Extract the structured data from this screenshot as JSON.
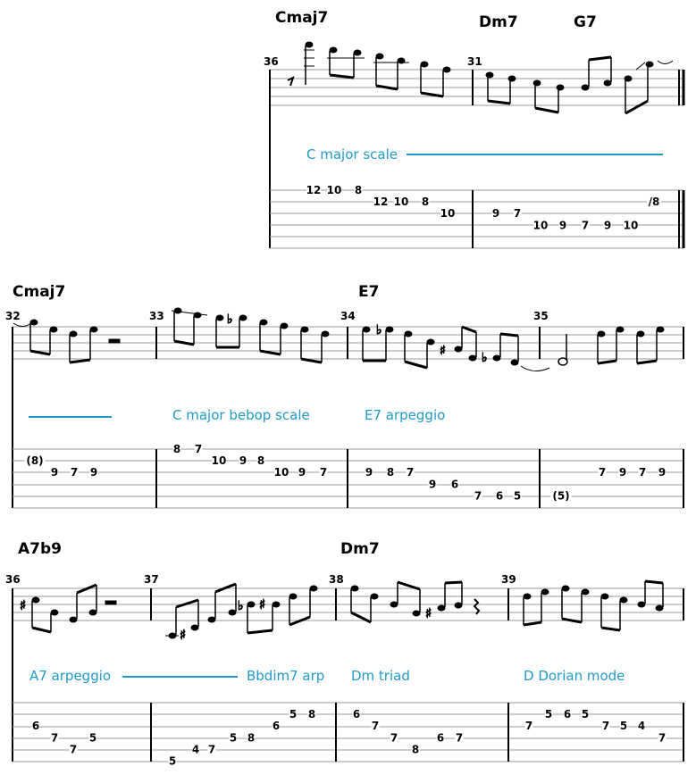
{
  "colors": {
    "annotation": "#1f9ac6",
    "ink": "#000000",
    "staff_line": "#9a9a9a"
  },
  "systems": [
    {
      "id": "system-1",
      "chords": [
        {
          "label": "Cmaj7"
        },
        {
          "label": "Dm7"
        },
        {
          "label": "G7"
        }
      ],
      "measures": [
        {
          "number": "36",
          "tab": [
            {
              "string": 1,
              "fret": "12"
            },
            {
              "string": 1,
              "fret": "10"
            },
            {
              "string": 1,
              "fret": "8"
            },
            {
              "string": 2,
              "fret": "12"
            },
            {
              "string": 2,
              "fret": "10"
            },
            {
              "string": 2,
              "fret": "8"
            },
            {
              "string": 3,
              "fret": "10"
            }
          ]
        },
        {
          "number": "31",
          "tab": [
            {
              "string": 3,
              "fret": "9"
            },
            {
              "string": 3,
              "fret": "7"
            },
            {
              "string": 4,
              "fret": "10"
            },
            {
              "string": 4,
              "fret": "9"
            },
            {
              "string": 4,
              "fret": "7"
            },
            {
              "string": 4,
              "fret": "9"
            },
            {
              "string": 4,
              "fret": "10"
            },
            {
              "string": 2,
              "fret": "/8"
            }
          ]
        }
      ],
      "annotations": [
        {
          "label": "C major scale",
          "line": true
        }
      ]
    },
    {
      "id": "system-2",
      "chords": [
        {
          "label": "Cmaj7"
        },
        {
          "label": "E7"
        }
      ],
      "measures": [
        {
          "number": "32",
          "tab": [
            {
              "string": 2,
              "fret": "(8)"
            },
            {
              "string": 3,
              "fret": "9"
            },
            {
              "string": 3,
              "fret": "7"
            },
            {
              "string": 3,
              "fret": "9"
            }
          ]
        },
        {
          "number": "33",
          "tab": [
            {
              "string": 1,
              "fret": "8"
            },
            {
              "string": 1,
              "fret": "7"
            },
            {
              "string": 2,
              "fret": "10"
            },
            {
              "string": 2,
              "fret": "9"
            },
            {
              "string": 2,
              "fret": "8"
            },
            {
              "string": 3,
              "fret": "10"
            },
            {
              "string": 3,
              "fret": "9"
            },
            {
              "string": 3,
              "fret": "7"
            }
          ]
        },
        {
          "number": "34",
          "tab": [
            {
              "string": 3,
              "fret": "9"
            },
            {
              "string": 3,
              "fret": "8"
            },
            {
              "string": 3,
              "fret": "7"
            },
            {
              "string": 4,
              "fret": "9"
            },
            {
              "string": 4,
              "fret": "6"
            },
            {
              "string": 5,
              "fret": "7"
            },
            {
              "string": 5,
              "fret": "6"
            },
            {
              "string": 5,
              "fret": "5"
            }
          ]
        },
        {
          "number": "35",
          "tab": [
            {
              "string": 5,
              "fret": "(5)"
            },
            {
              "string": 3,
              "fret": "7"
            },
            {
              "string": 3,
              "fret": "9"
            },
            {
              "string": 3,
              "fret": "7"
            },
            {
              "string": 3,
              "fret": "9"
            }
          ]
        }
      ],
      "annotations": [
        {
          "label": "",
          "line": true
        },
        {
          "label": "C major bebop scale",
          "line": false
        },
        {
          "label": "E7 arpeggio",
          "line": false
        }
      ]
    },
    {
      "id": "system-3",
      "chords": [
        {
          "label": "A7b9"
        },
        {
          "label": "Dm7"
        }
      ],
      "measures": [
        {
          "number": "36",
          "tab": [
            {
              "string": 3,
              "fret": "6"
            },
            {
              "string": 4,
              "fret": "7"
            },
            {
              "string": 5,
              "fret": "7"
            },
            {
              "string": 4,
              "fret": "5"
            }
          ]
        },
        {
          "number": "37",
          "tab": [
            {
              "string": 6,
              "fret": "5"
            },
            {
              "string": 5,
              "fret": "4"
            },
            {
              "string": 5,
              "fret": "7"
            },
            {
              "string": 4,
              "fret": "5"
            },
            {
              "string": 4,
              "fret": "8"
            },
            {
              "string": 3,
              "fret": "6"
            },
            {
              "string": 2,
              "fret": "5"
            },
            {
              "string": 2,
              "fret": "8"
            }
          ]
        },
        {
          "number": "38",
          "tab": [
            {
              "string": 2,
              "fret": "6"
            },
            {
              "string": 3,
              "fret": "7"
            },
            {
              "string": 4,
              "fret": "7"
            },
            {
              "string": 5,
              "fret": "8"
            },
            {
              "string": 4,
              "fret": "6"
            },
            {
              "string": 4,
              "fret": "7"
            }
          ]
        },
        {
          "number": "39",
          "tab": [
            {
              "string": 3,
              "fret": "7"
            },
            {
              "string": 2,
              "fret": "5"
            },
            {
              "string": 2,
              "fret": "6"
            },
            {
              "string": 2,
              "fret": "5"
            },
            {
              "string": 3,
              "fret": "7"
            },
            {
              "string": 3,
              "fret": "5"
            },
            {
              "string": 3,
              "fret": "4"
            },
            {
              "string": 4,
              "fret": "7"
            }
          ]
        }
      ],
      "annotations": [
        {
          "label": "A7 arpeggio",
          "line": true
        },
        {
          "label": "Bbdim7 arp",
          "line": false
        },
        {
          "label": "Dm triad",
          "line": false
        },
        {
          "label": "D Dorian mode",
          "line": false
        }
      ]
    }
  ]
}
